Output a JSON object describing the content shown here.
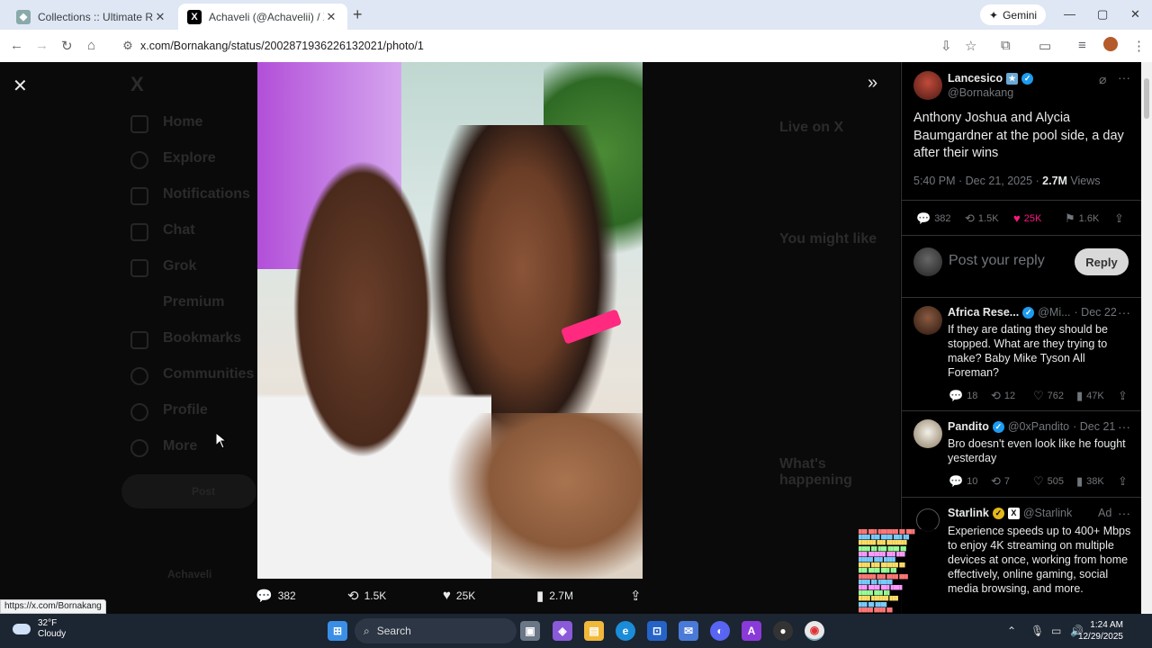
{
  "browser": {
    "tabs": [
      {
        "title": "Collections :: Ultimate Rap Leag",
        "active": false
      },
      {
        "title": "Achaveli (@Achavelii) / X",
        "active": true
      }
    ],
    "gemini_label": "Gemini",
    "url": "x.com/Bornakang/status/2002871936226132021/photo/1"
  },
  "background_nav": {
    "items": [
      "Home",
      "Explore",
      "Notifications",
      "Chat",
      "Grok",
      "Premium",
      "Bookmarks",
      "Communities",
      "Profile",
      "More"
    ],
    "post_label": "Post",
    "account": "Achaveli",
    "right_headers": [
      "Live on X",
      "You might like",
      "What's happening"
    ]
  },
  "media_actions": {
    "replies": "382",
    "reposts": "1.5K",
    "likes": "25K",
    "views": "2.7M"
  },
  "tweet": {
    "author_name": "Lancesico",
    "author_handle": "@Bornakang",
    "text": "Anthony Joshua and Alycia Baumgardner at the pool side, a day after their wins",
    "time": "5:40 PM · Dec 21, 2025 · ",
    "views_count": "2.7M",
    "views_label": " Views",
    "replies": "382",
    "reposts": "1.5K",
    "likes": "25K",
    "bookmarks": "1.6K",
    "reply_placeholder": "Post your reply",
    "reply_button": "Reply"
  },
  "replies": [
    {
      "name": "Africa Rese...",
      "handle": "@Mi...",
      "date": "· Dec 22",
      "text": "If they are dating they should be stopped. What are they trying to make? Baby Mike Tyson All Foreman?",
      "replies": "18",
      "reposts": "12",
      "likes": "762",
      "views": "47K"
    },
    {
      "name": "Pandito",
      "handle": "@0xPandito",
      "date": "· Dec 21",
      "text": "Bro doesn't even look like he fought yesterday",
      "replies": "10",
      "reposts": "7",
      "likes": "505",
      "views": "38K"
    },
    {
      "name": "Starlink",
      "handle": "@Starlink",
      "date": "Ad",
      "text": "Experience speeds up to 400+ Mbps to enjoy 4K streaming on multiple devices at once, working from home effectively, online gaming, social media browsing, and more."
    }
  ],
  "status_link": "https://x.com/Bornakang",
  "taskbar": {
    "temp": "32°F",
    "weather": "Cloudy",
    "search_placeholder": "Search",
    "time": "1:24 AM",
    "date": "12/29/2025"
  },
  "colors": {
    "like_pink": "#f91880",
    "verified_blue": "#1d9bf0",
    "background": "#000000"
  }
}
